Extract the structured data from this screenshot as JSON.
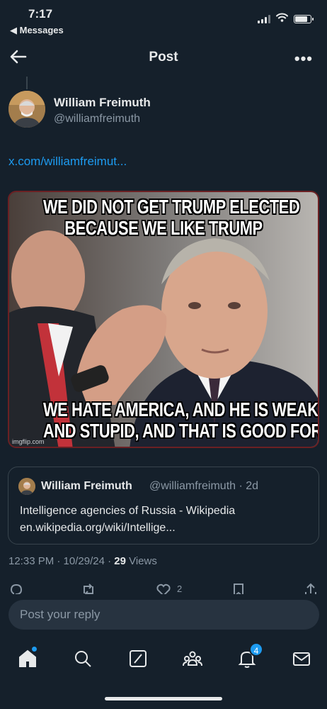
{
  "status": {
    "time": "7:17",
    "back_app": "◀ Messages",
    "icons": [
      "signal-icon",
      "wifi-icon",
      "battery-icon"
    ]
  },
  "nav": {
    "title": "Post",
    "back_icon": "arrow-left-icon",
    "more_label": "•••"
  },
  "post": {
    "author_name": "William Freimuth",
    "author_handle": "@williamfreimuth",
    "link_text": "x.com/williamfreimut...",
    "meme_top_line1": "WE DID NOT GET TRUMP ELECTED",
    "meme_top_line2": "BECAUSE WE LIKE TRUMP",
    "meme_bottom_line1": "WE HATE AMERICA, AND HE IS WEAK",
    "meme_bottom_line2": "AND STUPID, AND THAT IS GOOD FOR US",
    "watermark": "imgflip.com",
    "timestamp": "12:33 PM · 10/29/24 · ",
    "views_count": "29",
    "views_label": " Views"
  },
  "quote": {
    "author_name": "William Freimuth",
    "author_handle": "@williamfreimuth · 2d",
    "text_line1": "Intelligence agencies of Russia - Wikipedia",
    "text_line2": "en.wikipedia.org/wiki/Intellige..."
  },
  "actions": {
    "like_count": "2",
    "icons": [
      "reply-icon",
      "repost-icon",
      "like-icon",
      "bookmark-icon",
      "share-icon"
    ]
  },
  "reply": {
    "placeholder": "Post your reply"
  },
  "tabbar": {
    "notifications_badge": "4",
    "icons": [
      "home-icon",
      "search-icon",
      "grok-icon",
      "communities-icon",
      "notifications-icon",
      "messages-icon"
    ]
  },
  "colors": {
    "background": "#15202b",
    "accent": "#1d9bf0",
    "secondary_text": "#8b98a5"
  }
}
